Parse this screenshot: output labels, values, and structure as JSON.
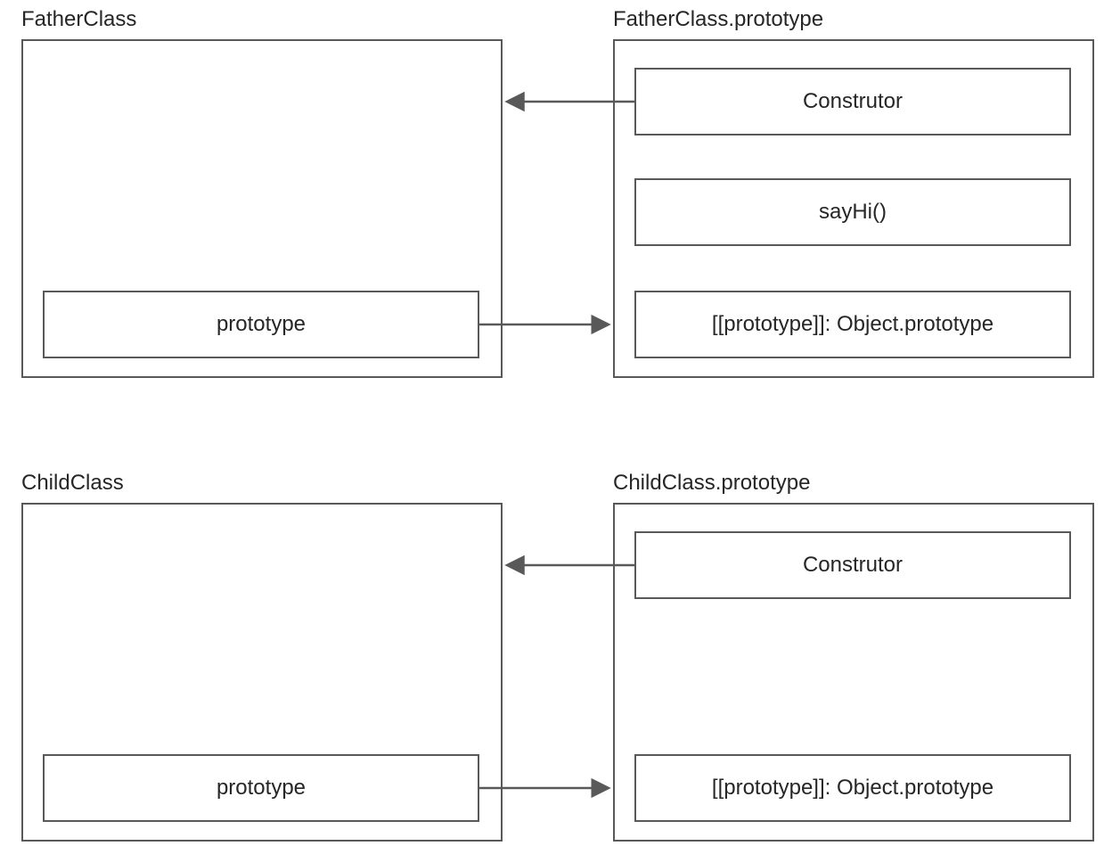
{
  "father": {
    "title": "FatherClass",
    "prototype_cell": "prototype",
    "proto_title": "FatherClass.prototype",
    "proto_cells": {
      "constructor": "Construtor",
      "method": "sayHi()",
      "slot": "[[prototype]]: Object.prototype"
    }
  },
  "child": {
    "title": "ChildClass",
    "prototype_cell": "prototype",
    "proto_title": "ChildClass.prototype",
    "proto_cells": {
      "constructor": "Construtor",
      "slot": "[[prototype]]: Object.prototype"
    }
  },
  "arrow_color": "#595959"
}
